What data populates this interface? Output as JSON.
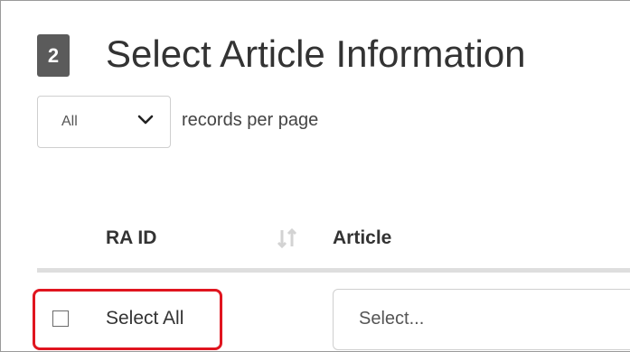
{
  "section": {
    "step_number": "2",
    "title": "Select Article Information"
  },
  "pagination": {
    "page_size_value": "All",
    "page_size_options": [
      "All"
    ],
    "records_label": "records per page"
  },
  "table": {
    "columns": [
      {
        "label": "RA ID",
        "sortable": true
      },
      {
        "label": "Article"
      }
    ],
    "select_all_label": "Select All",
    "select_all_checked": false,
    "article_placeholder": "Select..."
  },
  "icons": {
    "page_size_dropdown": "chevron-down-icon",
    "sort": "sort-icon"
  },
  "colors": {
    "badge": "#5b5b5b",
    "highlight": "#e0151f",
    "rule": "#dedede"
  }
}
